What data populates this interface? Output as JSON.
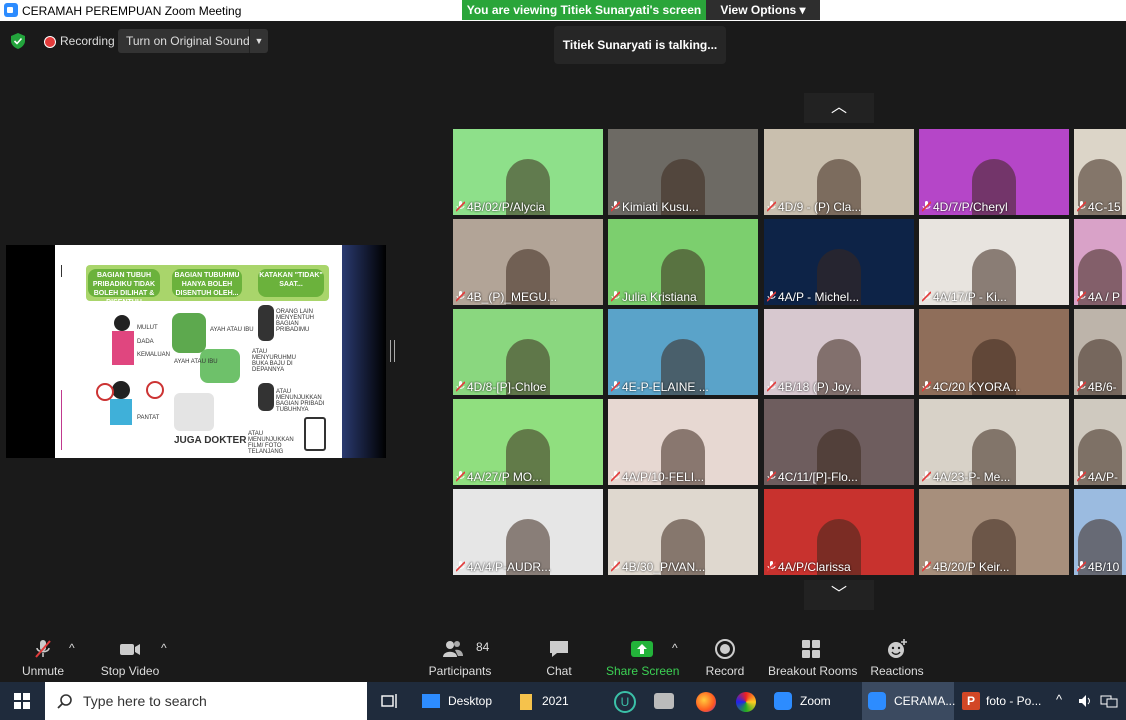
{
  "window": {
    "title": "CERAMAH PEREMPUAN   Zoom Meeting"
  },
  "banner": {
    "viewing": "You are viewing Titiek Sunaryati's screen",
    "view_options": "View Options"
  },
  "status": {
    "recording": "Recording",
    "original_sound": "Turn on Original Sound",
    "talking": "Titiek Sunaryati is talking..."
  },
  "tiles": [
    {
      "label": "4B/02/P/Alycia",
      "bg": "#8ee08a"
    },
    {
      "label": "Kimiati Kusu...",
      "bg": "#6d6a64"
    },
    {
      "label": "4D/9 - (P) Cla...",
      "bg": "#c9bfae"
    },
    {
      "label": "4D/7/P/Cheryl",
      "bg": "#b546c8"
    },
    {
      "label": "4C-15",
      "bg": "#dcd5c8"
    },
    {
      "label": "4B_(P)_MEGU...",
      "bg": "#b2a497"
    },
    {
      "label": "Julia Kristiana",
      "bg": "#7ccf6e"
    },
    {
      "label": "4A/P - Michel...",
      "bg": "#0d2347"
    },
    {
      "label": "4A/17/P - Ki...",
      "bg": "#e8e4df"
    },
    {
      "label": "4A / P",
      "bg": "#d9a2c8"
    },
    {
      "label": "4D/8-[P]-Chloe",
      "bg": "#8ad77f"
    },
    {
      "label": "4E-P-ELAINE ...",
      "bg": "#5aa3c9"
    },
    {
      "label": "4B/18 (P) Joy...",
      "bg": "#d7c8cf"
    },
    {
      "label": "4C/20 KYORA...",
      "bg": "#8f6e5a"
    },
    {
      "label": "4B/6-",
      "bg": "#bdb4aa"
    },
    {
      "label": "4A/27/P MO...",
      "bg": "#90df7f"
    },
    {
      "label": "4A/P/10-FELI...",
      "bg": "#e7d8d2"
    },
    {
      "label": "4C/11/[P]-Flo...",
      "bg": "#6e5d5e"
    },
    {
      "label": "4A/23-P- Me...",
      "bg": "#d8d2c8"
    },
    {
      "label": "4A/P-",
      "bg": "#cfc9bf"
    },
    {
      "label": "4A/4/P-AUDR...",
      "bg": "#e6e6e6"
    },
    {
      "label": "4B/30_P/VAN...",
      "bg": "#dfd8cf"
    },
    {
      "label": "4A/P/Clarissa",
      "bg": "#c8322e"
    },
    {
      "label": "4B/20/P Keir...",
      "bg": "#a78f7c"
    },
    {
      "label": "4B/10",
      "bg": "#9bbbe0"
    }
  ],
  "slide": {
    "bubble1": "BAGIAN TUBUH PRIBADIKU TIDAK BOLEH DILIHAT & DISENTUH SEMBARANG ORANG",
    "bubble2": "BAGIAN TUBUHMU HANYA BOLEH DISENTUH OLEH...",
    "bubble3": "KATAKAN \"TIDAK\" SAAT...",
    "n1": "MULUT",
    "n2": "DADA",
    "n3": "KEMALUAN",
    "n4": "PANTAT",
    "n5": "AYAH ATAU IBU",
    "n6": "AYAH ATAU IBU",
    "n7": "ORANG LAIN MENYENTUH BAGIAN PRIBADIMU",
    "n8": "ATAU MENYURUHMU BUKA BAJU DI DEPANNYA",
    "n9": "ATAU MENUNJUKKAN BAGIAN PRIBADI TUBUHNYA",
    "n10": "ATAU MENUNJUKKAN FILM/ FOTO TELANJANG",
    "big": "JUGA DOKTER"
  },
  "toolbar": {
    "unmute": "Unmute",
    "stop_video": "Stop Video",
    "participants_count": "84",
    "participants": "Participants",
    "chat": "Chat",
    "share_screen": "Share Screen",
    "record": "Record",
    "breakout": "Breakout Rooms",
    "reactions": "Reactions"
  },
  "taskbar": {
    "search_placeholder": "Type here to search",
    "desktop": "Desktop",
    "folder": "2021",
    "zoom": "Zoom",
    "ceramah": "CERAMA...",
    "foto": "foto - Po..."
  },
  "colors": {
    "accent_green": "#2aa53a",
    "zoom_blue": "#2d8cff",
    "mute_red": "#e33b3b"
  }
}
